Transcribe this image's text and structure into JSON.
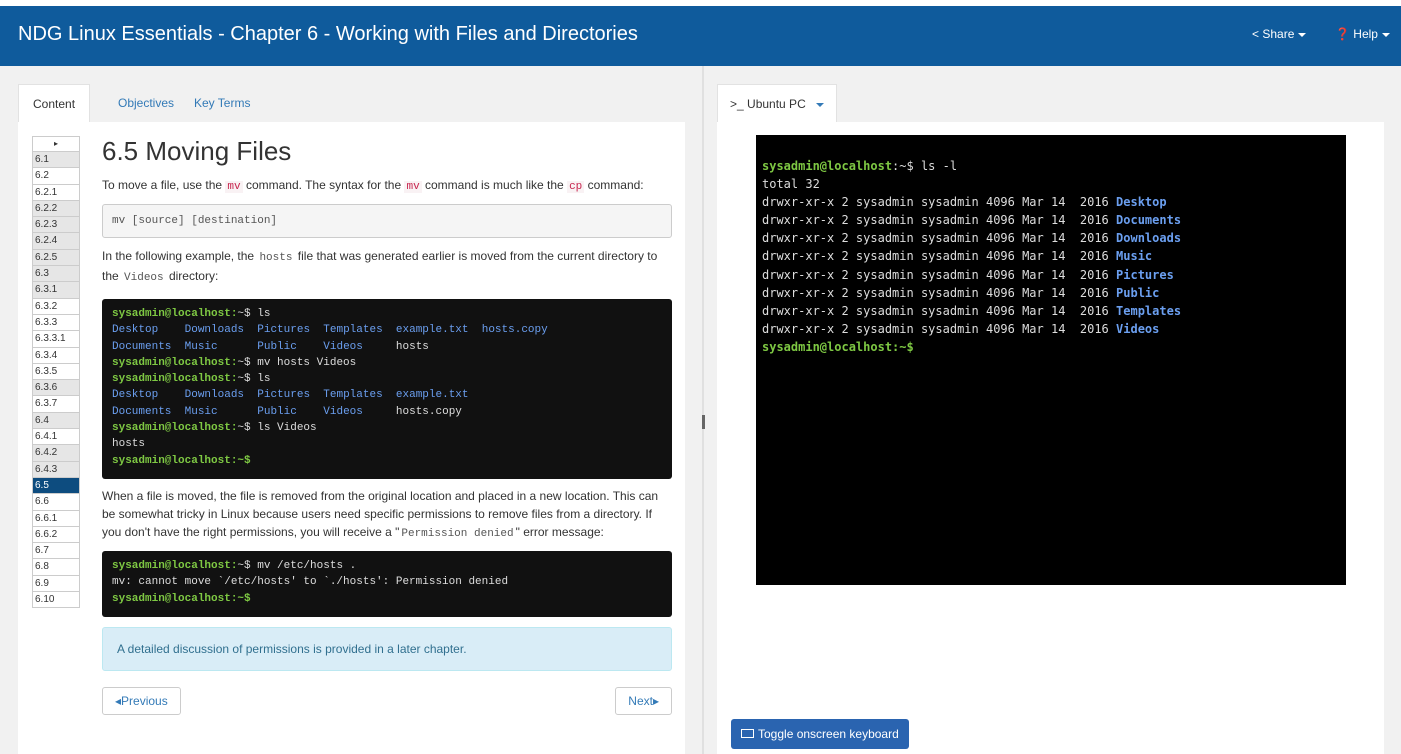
{
  "header": {
    "title": "NDG Linux Essentials - Chapter 6 - Working with Files and Directories",
    "share_label": "Share",
    "help_label": "Help"
  },
  "tabs": [
    {
      "label": "Content"
    },
    {
      "label": "Objectives"
    },
    {
      "label": "Key Terms"
    }
  ],
  "toc": {
    "toggle_glyph": "▸",
    "items": [
      "6.1",
      "6.2",
      "6.2.1",
      "6.2.2",
      "6.2.3",
      "6.2.4",
      "6.2.5",
      "6.3",
      "6.3.1",
      "6.3.2",
      "6.3.3",
      "6.3.3.1",
      "6.3.4",
      "6.3.5",
      "6.3.6",
      "6.3.7",
      "6.4",
      "6.4.1",
      "6.4.2",
      "6.4.3",
      "6.5",
      "6.6",
      "6.6.1",
      "6.6.2",
      "6.7",
      "6.8",
      "6.9",
      "6.10"
    ],
    "active": "6.5"
  },
  "content": {
    "heading": "6.5 Moving Files",
    "p1": {
      "a": "To move a file, use the ",
      "c1": "mv",
      "b": " command. The syntax for the ",
      "c2": "mv",
      "c": " command is much like the ",
      "c3": "cp",
      "d": " command:"
    },
    "syntax": "mv [source] [destination]",
    "p2": {
      "a": "In the following example, the ",
      "c1": "hosts",
      "b": " file that was generated earlier is moved from the current directory to the ",
      "c2": "Videos",
      "c": " directory:"
    },
    "term1": {
      "l1_prompt": "sysadmin@localhost:",
      "l1_rest": "~$ ls",
      "l2_d1": "Desktop",
      "l2_d2": "Downloads",
      "l2_d3": "Pictures",
      "l2_d4": "Templates",
      "l2_d5": "example.txt",
      "l2_d6": "hosts.copy",
      "l3_d1": "Documents",
      "l3_d2": "Music",
      "l3_d3": "Public",
      "l3_d4": "Videos",
      "l3_f1": "hosts",
      "l4_prompt": "sysadmin@localhost:",
      "l4_rest": "~$ mv hosts Videos",
      "l5_prompt": "sysadmin@localhost:",
      "l5_rest": "~$ ls",
      "l6_d1": "Desktop",
      "l6_d2": "Downloads",
      "l6_d3": "Pictures",
      "l6_d4": "Templates",
      "l6_d5": "example.txt",
      "l7_d1": "Documents",
      "l7_d2": "Music",
      "l7_d3": "Public",
      "l7_d4": "Videos",
      "l7_f1": "hosts.copy",
      "l8_prompt": "sysadmin@localhost:",
      "l8_rest": "~$ ls Videos",
      "l9": "hosts",
      "l10_prompt": "sysadmin@localhost:",
      "l10_rest": "~$"
    },
    "p3": {
      "a": "When a file is moved, the file is removed from the original location and placed in a new location. This can be somewhat tricky in Linux because users need specific permissions to remove files from a directory. If you don't have the right permissions, you will receive a \"",
      "c1": "Permission denied",
      "b": "\" error message:"
    },
    "term2": {
      "l1_prompt": "sysadmin@localhost:",
      "l1_rest": "~$ mv /etc/hosts .",
      "l2": "mv: cannot move `/etc/hosts' to `./hosts': Permission denied",
      "l3_prompt": "sysadmin@localhost:",
      "l3_rest": "~$"
    },
    "note": "A detailed discussion of permissions is provided in a later chapter.",
    "prev_label": "Previous",
    "next_label": "Next"
  },
  "right": {
    "tab_label": "Ubuntu PC",
    "tab_prefix": ">_",
    "terminal": {
      "prompt": "sysadmin@localhost",
      "cmd": ":~$ ls -l",
      "total": "total 32",
      "perm_prefix": "drwxr-xr-x 2 sysadmin sysadmin 4096 Mar 14  2016 ",
      "dirs": [
        "Desktop",
        "Documents",
        "Downloads",
        "Music",
        "Pictures",
        "Public",
        "Templates",
        "Videos"
      ],
      "end_prompt": "sysadmin@localhost",
      "end_rest": ":~$"
    },
    "keyboard_button": "Toggle onscreen keyboard"
  },
  "colors": {
    "header_bg": "#0f5b9c",
    "prompt_green": "#7ec843",
    "dir_blue": "#6b9ff0",
    "toc_active": "#0d4c7f"
  }
}
